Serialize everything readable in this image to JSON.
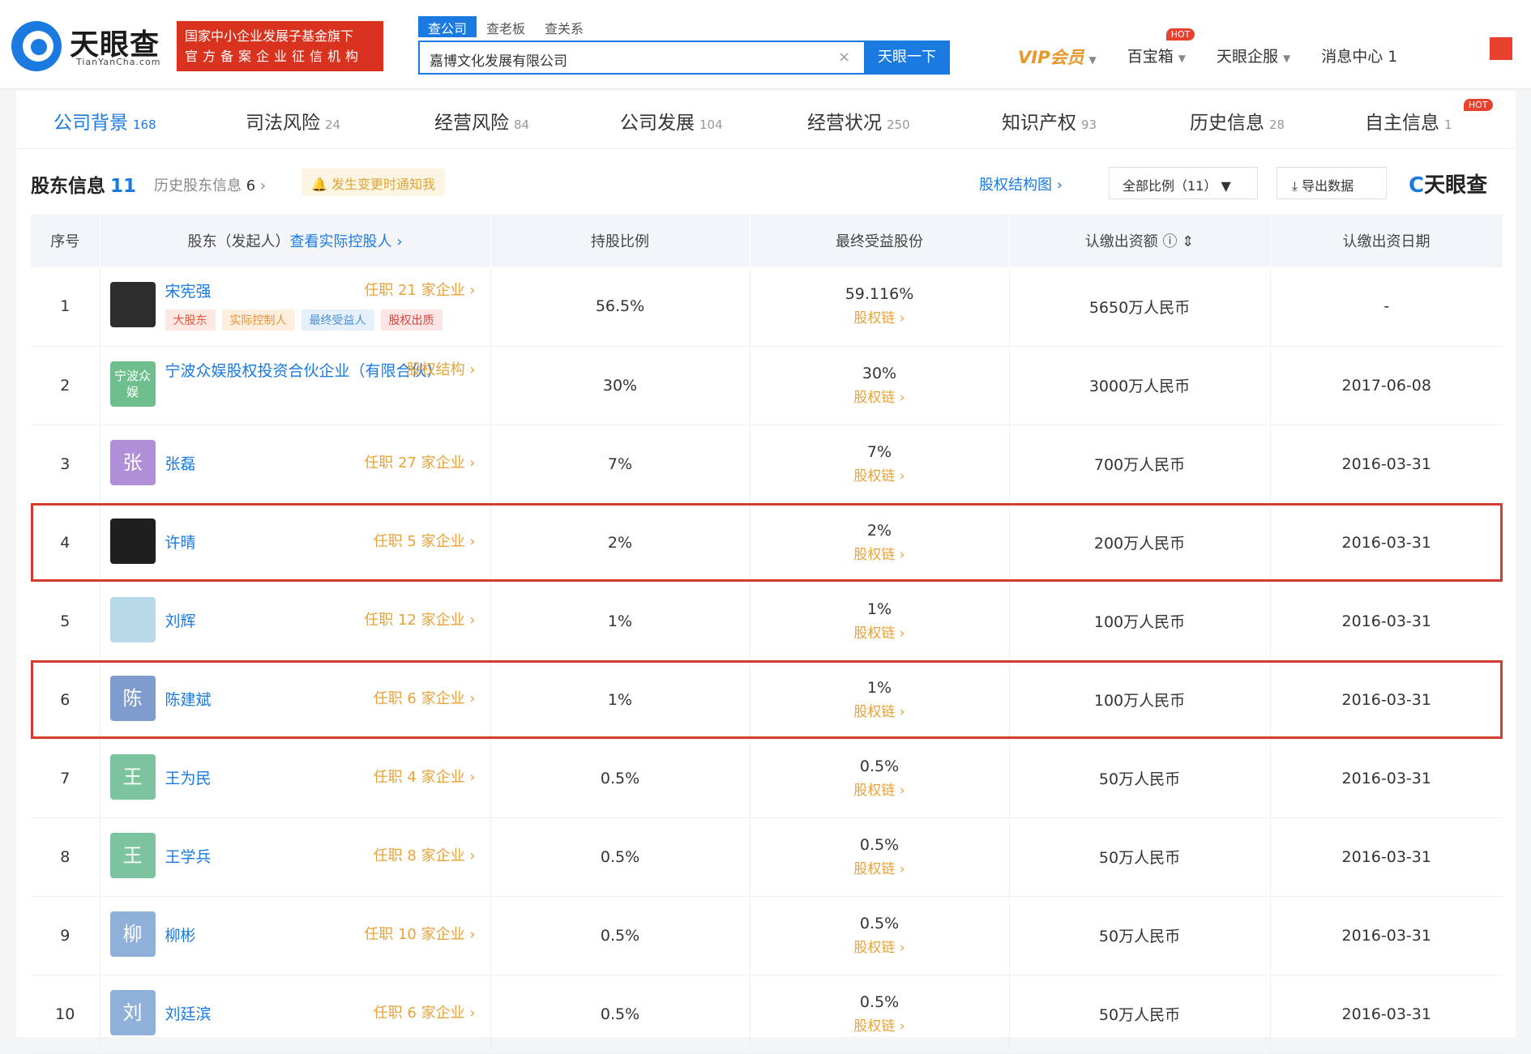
{
  "header": {
    "logo_cn": "天眼查",
    "logo_en": "TianYanCha.com",
    "badge_line1": "国家中小企业发展子基金旗下",
    "badge_line2": "官方备案企业征信机构",
    "search_tabs": [
      "查公司",
      "查老板",
      "查关系"
    ],
    "search_value": "嘉博文化发展有限公司",
    "search_clear": "×",
    "search_button": "天眼一下",
    "nav": [
      {
        "label": "VIP会员",
        "caret": "▼"
      },
      {
        "label": "百宝箱",
        "caret": "▼",
        "badge": "HOT"
      },
      {
        "label": "天眼企服",
        "caret": "▼"
      },
      {
        "label": "消息中心 1",
        "caret": ""
      }
    ]
  },
  "tabs": [
    {
      "label": "公司背景",
      "count": "168"
    },
    {
      "label": "司法风险",
      "count": "24"
    },
    {
      "label": "经营风险",
      "count": "84"
    },
    {
      "label": "公司发展",
      "count": "104"
    },
    {
      "label": "经营状况",
      "count": "250"
    },
    {
      "label": "知识产权",
      "count": "93"
    },
    {
      "label": "历史信息",
      "count": "28"
    },
    {
      "label": "自主信息",
      "count": "1",
      "badge": "HOT"
    }
  ],
  "section": {
    "title": "股东信息",
    "count": "11",
    "history_label": "历史股东信息",
    "history_count": "6",
    "history_arrow": "›",
    "notify": "🔔 发生变更时通知我",
    "structure_link": "股权结构图 ›",
    "ratio_select": "全部比例（11）  ▼",
    "export": "⤓ 导出数据",
    "brand_c": "C",
    "brand": "天眼查"
  },
  "table": {
    "headers": {
      "index": "序号",
      "holder": "股东（发起人）",
      "holder_link": "查看实际控股人 ›",
      "ratio": "持股比例",
      "benefit": "最终受益股份",
      "capital": "认缴出资额 ⓘ ⇕",
      "date": "认缴出资日期"
    },
    "chain_label": "股权链 ›",
    "rows": [
      {
        "index": "1",
        "avatar": "",
        "avatar_color": "#2d2d2d",
        "name": "宋宪强",
        "posts": "任职 21 家企业 ›",
        "tags": [
          "大股东",
          "实际控制人",
          "最终受益人",
          "股权出质"
        ],
        "ratio": "56.5%",
        "benefit": "59.116%",
        "capital": "5650万人民币",
        "date": "-"
      },
      {
        "index": "2",
        "avatar": "宁波众娱",
        "avatar_color": "#6fbf8e",
        "name": "宁波众娱股权投资合伙企业（有限合伙）",
        "posts": "股权结构 ›",
        "ratio": "30%",
        "benefit": "30%",
        "capital": "3000万人民币",
        "date": "2017-06-08"
      },
      {
        "index": "3",
        "avatar": "张",
        "avatar_color": "#b08fd8",
        "name": "张磊",
        "posts": "任职 27 家企业 ›",
        "ratio": "7%",
        "benefit": "7%",
        "capital": "700万人民币",
        "date": "2016-03-31"
      },
      {
        "index": "4",
        "avatar": "",
        "avatar_color": "#1f1f1f",
        "name": "许晴",
        "posts": "任职 5 家企业 ›",
        "ratio": "2%",
        "benefit": "2%",
        "capital": "200万人民币",
        "date": "2016-03-31",
        "highlight": true
      },
      {
        "index": "5",
        "avatar": "",
        "avatar_color": "#b8d9e8",
        "name": "刘辉",
        "posts": "任职 12 家企业 ›",
        "ratio": "1%",
        "benefit": "1%",
        "capital": "100万人民币",
        "date": "2016-03-31"
      },
      {
        "index": "6",
        "avatar": "陈",
        "avatar_color": "#7e9ccd",
        "name": "陈建斌",
        "posts": "任职 6 家企业 ›",
        "ratio": "1%",
        "benefit": "1%",
        "capital": "100万人民币",
        "date": "2016-03-31",
        "highlight": true
      },
      {
        "index": "7",
        "avatar": "王",
        "avatar_color": "#7cc4a0",
        "name": "王为民",
        "posts": "任职 4 家企业 ›",
        "ratio": "0.5%",
        "benefit": "0.5%",
        "capital": "50万人民币",
        "date": "2016-03-31"
      },
      {
        "index": "8",
        "avatar": "王",
        "avatar_color": "#7cc4a0",
        "name": "王学兵",
        "posts": "任职 8 家企业 ›",
        "ratio": "0.5%",
        "benefit": "0.5%",
        "capital": "50万人民币",
        "date": "2016-03-31"
      },
      {
        "index": "9",
        "avatar": "柳",
        "avatar_color": "#8fb0d8",
        "name": "柳彬",
        "posts": "任职 10 家企业 ›",
        "ratio": "0.5%",
        "benefit": "0.5%",
        "capital": "50万人民币",
        "date": "2016-03-31"
      },
      {
        "index": "10",
        "avatar": "刘",
        "avatar_color": "#8fb0d8",
        "name": "刘廷滨",
        "posts": "任职 6 家企业 ›",
        "ratio": "0.5%",
        "benefit": "0.5%",
        "capital": "50万人民币",
        "date": "2016-03-31"
      }
    ]
  }
}
